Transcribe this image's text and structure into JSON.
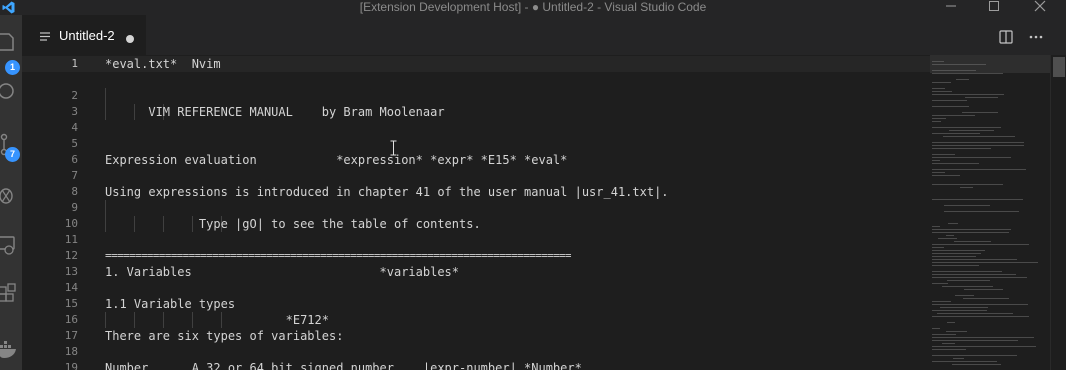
{
  "window": {
    "title": "[Extension Development Host] - ● Untitled-2 - Visual Studio Code"
  },
  "activity_bar": {
    "items": [
      {
        "icon": "explorer-icon",
        "badge": "1"
      },
      {
        "icon": "search-icon",
        "badge": ""
      },
      {
        "icon": "source-control-icon",
        "badge": "7"
      },
      {
        "icon": "run-debug-icon",
        "badge": ""
      },
      {
        "icon": "remote-explorer-icon",
        "badge": ""
      },
      {
        "icon": "extensions-icon",
        "badge": ""
      },
      {
        "icon": "docker-icon",
        "badge": ""
      }
    ]
  },
  "tabs": [
    {
      "label": "Untitled-2",
      "dirty": true
    }
  ],
  "toolbar": {
    "split_editor": "split-editor-icon",
    "more_actions": "more-actions-icon"
  },
  "editor": {
    "lines": [
      {
        "n": "1",
        "text": "*eval.txt*  Nvim"
      },
      {
        "n": "2",
        "text": ""
      },
      {
        "n": "3",
        "text": "      VIM REFERENCE MANUAL    by Bram Moolenaar"
      },
      {
        "n": "4",
        "text": ""
      },
      {
        "n": "5",
        "text": ""
      },
      {
        "n": "6",
        "text": "Expression evaluation           *expression* *expr* *E15* *eval*"
      },
      {
        "n": "7",
        "text": ""
      },
      {
        "n": "8",
        "text": "Using expressions is introduced in chapter 41 of the user manual |usr_41.txt|."
      },
      {
        "n": "9",
        "text": ""
      },
      {
        "n": "10",
        "text": "             Type |gO| to see the table of contents."
      },
      {
        "n": "11",
        "text": ""
      },
      {
        "n": "12",
        "text": "=============================================================================="
      },
      {
        "n": "13",
        "text": "1. Variables                          *variables*"
      },
      {
        "n": "14",
        "text": ""
      },
      {
        "n": "15",
        "text": "1.1 Variable types"
      },
      {
        "n": "16",
        "text": "                         *E712*"
      },
      {
        "n": "17",
        "text": "There are six types of variables:"
      },
      {
        "n": "18",
        "text": ""
      },
      {
        "n": "19",
        "text": "Number      A 32 or 64 bit signed number.   |expr-number| *Number*"
      }
    ]
  }
}
